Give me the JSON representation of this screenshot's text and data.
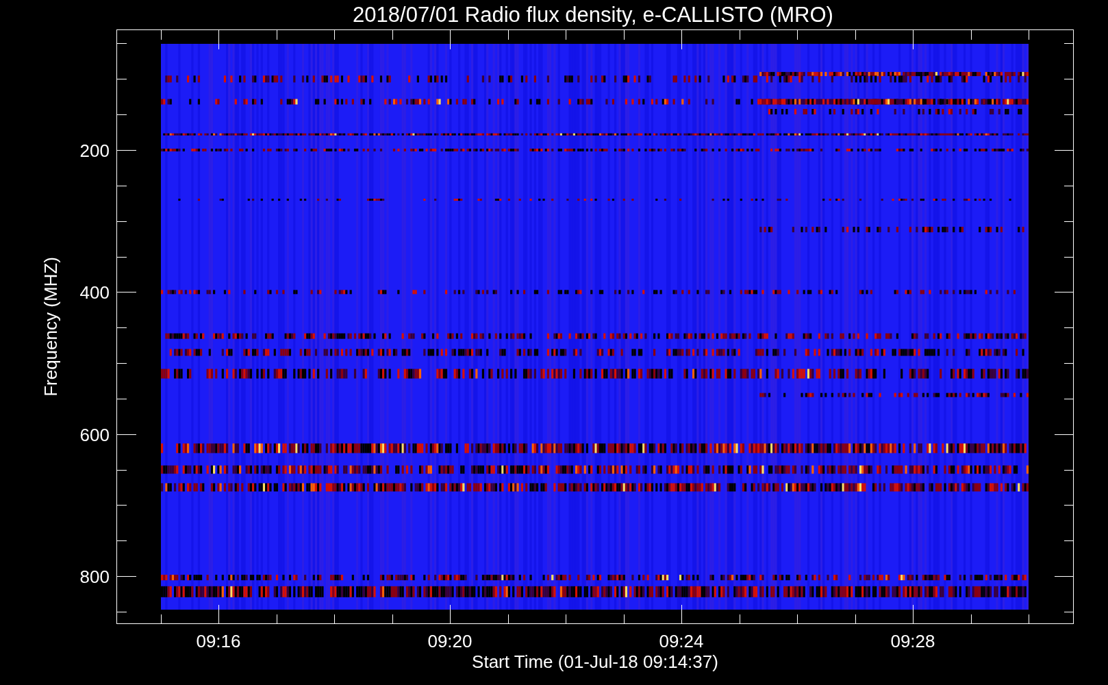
{
  "title": "2018/07/01  Radio flux density, e-CALLISTO (MRO)",
  "y_axis": {
    "label": "Frequency (MHZ)",
    "ticks": [
      "200",
      "400",
      "600",
      "800"
    ]
  },
  "x_axis": {
    "label": "Start Time (01-Jul-18 09:14:37)",
    "ticks": [
      "09:16",
      "09:20",
      "09:24",
      "09:28"
    ]
  }
}
